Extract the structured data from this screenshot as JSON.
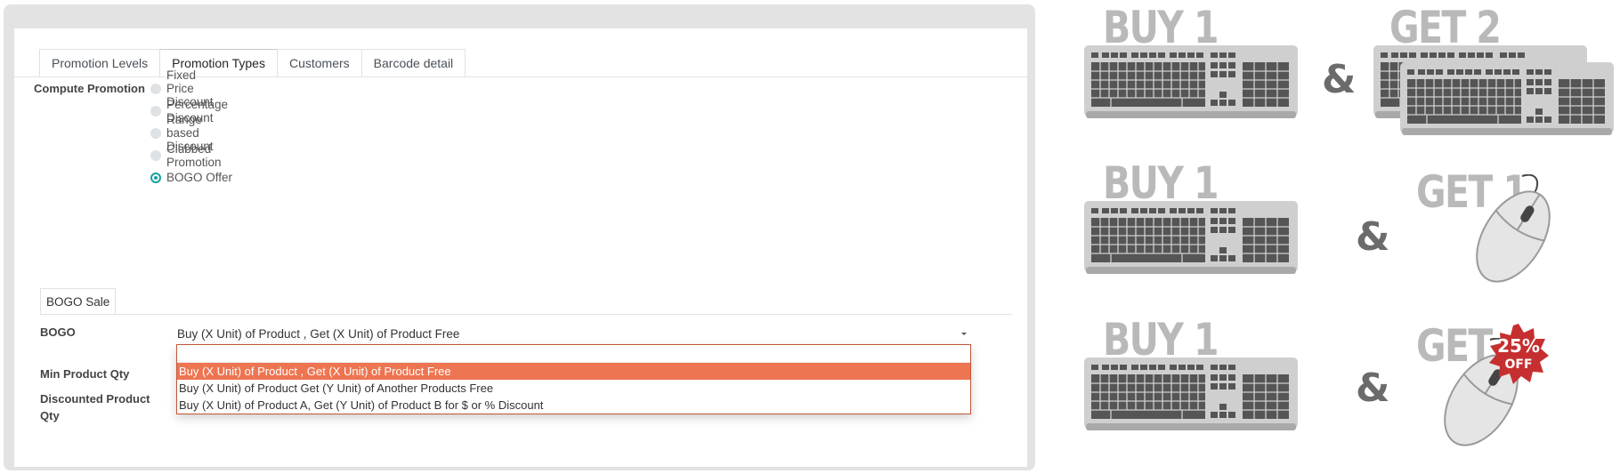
{
  "tabs": [
    {
      "label": "Promotion Levels"
    },
    {
      "label": "Promotion Types"
    },
    {
      "label": "Customers"
    },
    {
      "label": "Barcode detail"
    }
  ],
  "compute": {
    "label": "Compute Promotion",
    "options": [
      {
        "label": "Fixed Price Discount",
        "checked": false
      },
      {
        "label": "Percentage Discount",
        "checked": false
      },
      {
        "label": "Range based Discount",
        "checked": false
      },
      {
        "label": "Clubbed Promotion",
        "checked": false
      },
      {
        "label": "BOGO Offer",
        "checked": true
      }
    ]
  },
  "bogo_tab": {
    "label": "BOGO Sale"
  },
  "bogo": {
    "label": "BOGO",
    "selected": "Buy (X Unit) of Product , Get (X Unit) of Product Free",
    "options": [
      "Buy (X Unit) of Product , Get (X Unit) of Product Free",
      "Buy (X Unit) of Product Get (Y Unit) of Another Products Free",
      "Buy (X Unit) of Product A, Get (Y Unit) of Product B for $ or % Discount"
    ]
  },
  "fields": {
    "min_qty_label": "Min Product Qty",
    "discounted_qty_label_line1": "Discounted Product",
    "discounted_qty_label_line2": "Qty"
  },
  "promo": {
    "rows": [
      {
        "buy": "BUY 1",
        "amp": "&",
        "get": "GET 2",
        "item": "keyboard-x2"
      },
      {
        "buy": "BUY 1",
        "amp": "&",
        "get": "GET 1",
        "item": "mouse"
      },
      {
        "buy": "BUY 1",
        "amp": "&",
        "get": "GET",
        "item": "mouse"
      }
    ],
    "badge_line1": "25%",
    "badge_line2": "OFF"
  },
  "colors": {
    "accent_teal": "#17a2a0",
    "highlight_orange": "#ee7551",
    "badge_red": "#c62f2f",
    "promo_gray": "#b9b9b9"
  }
}
